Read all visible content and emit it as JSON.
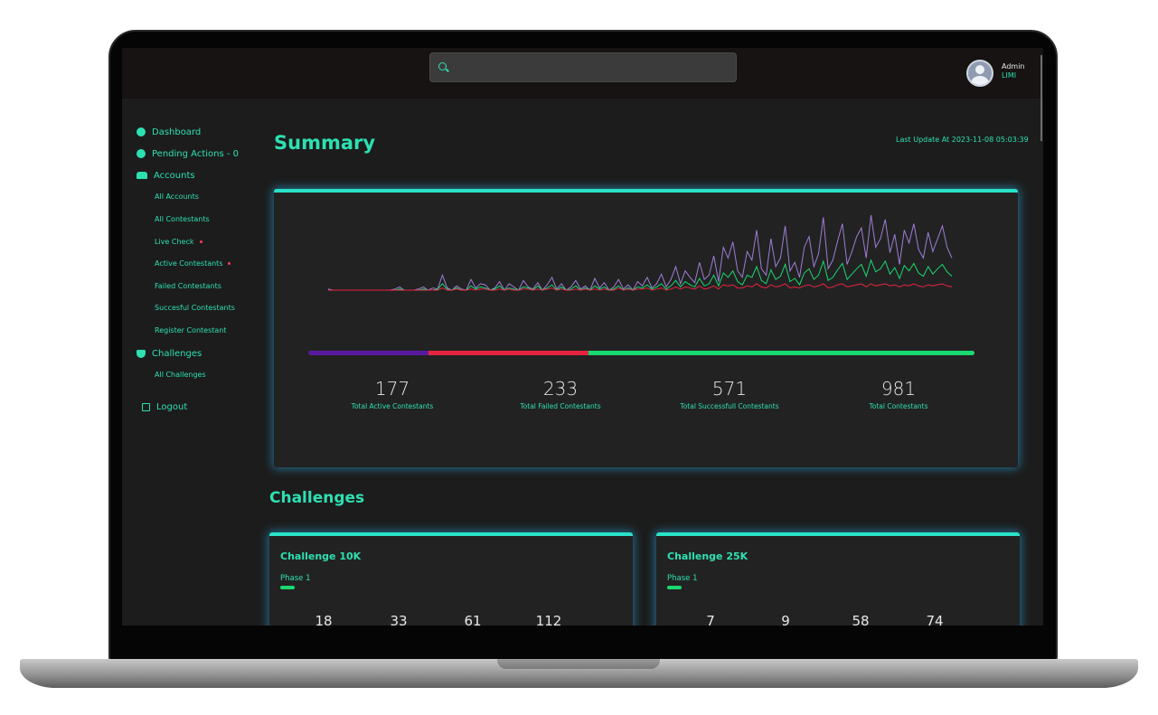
{
  "header": {
    "search_placeholder": "",
    "user": {
      "role": "Admin",
      "name": "LIMI"
    }
  },
  "sidebar": {
    "items": [
      {
        "label": "Dashboard",
        "icon": "dashboard-icon"
      },
      {
        "label": "Pending Actions - 0",
        "icon": "alert-icon"
      },
      {
        "label": "Accounts",
        "icon": "users-icon"
      },
      {
        "label": "Challenges",
        "icon": "trophy-icon"
      },
      {
        "label": "Logout",
        "icon": "logout-icon"
      }
    ],
    "accounts_sub": [
      {
        "label": "All Accounts",
        "badge": false
      },
      {
        "label": "All Contestants",
        "badge": false
      },
      {
        "label": "Live Check",
        "badge": true
      },
      {
        "label": "Active Contestants",
        "badge": true
      },
      {
        "label": "Failed Contestants",
        "badge": false
      },
      {
        "label": "Succesful Contestants",
        "badge": false
      },
      {
        "label": "Register Contestant",
        "badge": false
      }
    ],
    "challenges_sub": [
      {
        "label": "All Challenges"
      }
    ]
  },
  "summary": {
    "title": "Summary",
    "last_update": "Last Update At 2023-11-08 05:03:39",
    "progress": {
      "active_pct": 18,
      "failed_pct": 24,
      "success_pct": 58
    },
    "stats": [
      {
        "value": "177",
        "label": "Total Active Contestants"
      },
      {
        "value": "233",
        "label": "Total Failed Contestants"
      },
      {
        "value": "571",
        "label": "Total Successfull Contestants"
      },
      {
        "value": "981",
        "label": "Total Contestants"
      }
    ]
  },
  "chart_data": {
    "type": "line",
    "title": "",
    "xlabel": "",
    "ylabel": "",
    "grid": false,
    "series": [
      {
        "color": "#9d7ed6",
        "values": [
          1,
          0,
          0,
          0,
          0,
          0,
          0,
          0,
          0,
          0,
          0,
          0,
          0,
          0,
          1,
          3,
          0,
          0,
          0,
          1,
          3,
          0,
          2,
          1,
          14,
          2,
          0,
          4,
          1,
          0,
          10,
          2,
          6,
          5,
          0,
          2,
          8,
          0,
          6,
          3,
          0,
          9,
          3,
          1,
          7,
          0,
          5,
          12,
          1,
          6,
          0,
          3,
          9,
          1,
          4,
          0,
          11,
          2,
          7,
          0,
          3,
          10,
          1,
          5,
          0,
          8,
          4,
          12,
          2,
          6,
          15,
          3,
          10,
          22,
          6,
          18,
          12,
          7,
          26,
          10,
          14,
          32,
          8,
          40,
          30,
          45,
          18,
          12,
          36,
          28,
          56,
          20,
          14,
          48,
          22,
          30,
          60,
          18,
          26,
          12,
          40,
          50,
          22,
          34,
          68,
          20,
          28,
          46,
          62,
          24,
          36,
          50,
          58,
          30,
          70,
          40,
          48,
          66,
          35,
          52,
          24,
          56,
          44,
          62,
          38,
          30,
          54,
          36,
          48,
          60,
          40,
          30
        ],
        "peaks_hint": "tallest"
      },
      {
        "color": "#18d96f",
        "values": [
          0,
          0,
          0,
          0,
          0,
          0,
          0,
          0,
          0,
          0,
          0,
          0,
          0,
          0,
          0,
          1,
          0,
          0,
          0,
          0,
          1,
          0,
          0,
          1,
          6,
          1,
          0,
          2,
          0,
          0,
          4,
          1,
          3,
          2,
          0,
          1,
          4,
          0,
          2,
          1,
          0,
          3,
          2,
          0,
          4,
          0,
          2,
          5,
          0,
          3,
          0,
          1,
          4,
          0,
          2,
          0,
          4,
          1,
          3,
          0,
          1,
          4,
          0,
          2,
          0,
          3,
          2,
          5,
          1,
          3,
          6,
          1,
          4,
          9,
          3,
          8,
          5,
          3,
          11,
          4,
          6,
          14,
          4,
          16,
          12,
          18,
          8,
          5,
          14,
          12,
          22,
          9,
          6,
          19,
          10,
          13,
          24,
          8,
          11,
          5,
          16,
          20,
          10,
          14,
          27,
          9,
          12,
          19,
          25,
          10,
          15,
          20,
          24,
          13,
          28,
          17,
          20,
          27,
          15,
          21,
          11,
          23,
          18,
          25,
          16,
          13,
          22,
          15,
          20,
          24,
          17,
          13
        ]
      },
      {
        "color": "#e5253f",
        "values": [
          0,
          0,
          0,
          0,
          0,
          0,
          0,
          0,
          0,
          0,
          0,
          0,
          0,
          0,
          0,
          0,
          0,
          0,
          0,
          0,
          0,
          0,
          0,
          0,
          2,
          0,
          0,
          1,
          0,
          0,
          1,
          0,
          1,
          1,
          0,
          0,
          1,
          0,
          1,
          0,
          0,
          1,
          1,
          0,
          1,
          0,
          1,
          2,
          0,
          1,
          0,
          0,
          1,
          0,
          1,
          0,
          1,
          0,
          1,
          0,
          0,
          2,
          0,
          1,
          0,
          1,
          1,
          2,
          0,
          1,
          2,
          0,
          1,
          3,
          1,
          3,
          2,
          1,
          4,
          1,
          2,
          4,
          1,
          5,
          4,
          5,
          2,
          2,
          4,
          3,
          6,
          3,
          2,
          5,
          3,
          4,
          6,
          2,
          3,
          2,
          4,
          5,
          3,
          4,
          6,
          2,
          3,
          5,
          6,
          3,
          4,
          5,
          6,
          3,
          6,
          4,
          5,
          6,
          4,
          5,
          3,
          5,
          4,
          6,
          4,
          3,
          5,
          4,
          5,
          6,
          4,
          3
        ]
      }
    ]
  },
  "challenges": {
    "title": "Challenges",
    "cards": [
      {
        "title": "Challenge 10K",
        "phase": "Phase 1",
        "values": [
          "18",
          "33",
          "61",
          "112"
        ]
      },
      {
        "title": "Challenge 25K",
        "phase": "Phase 1",
        "values": [
          "7",
          "9",
          "58",
          "74"
        ]
      }
    ]
  },
  "colors": {
    "accent": "#2de0b2",
    "active": "#5a1aa0",
    "failed": "#e5253f",
    "success": "#18d96f",
    "card_border": "#29e2c7"
  }
}
